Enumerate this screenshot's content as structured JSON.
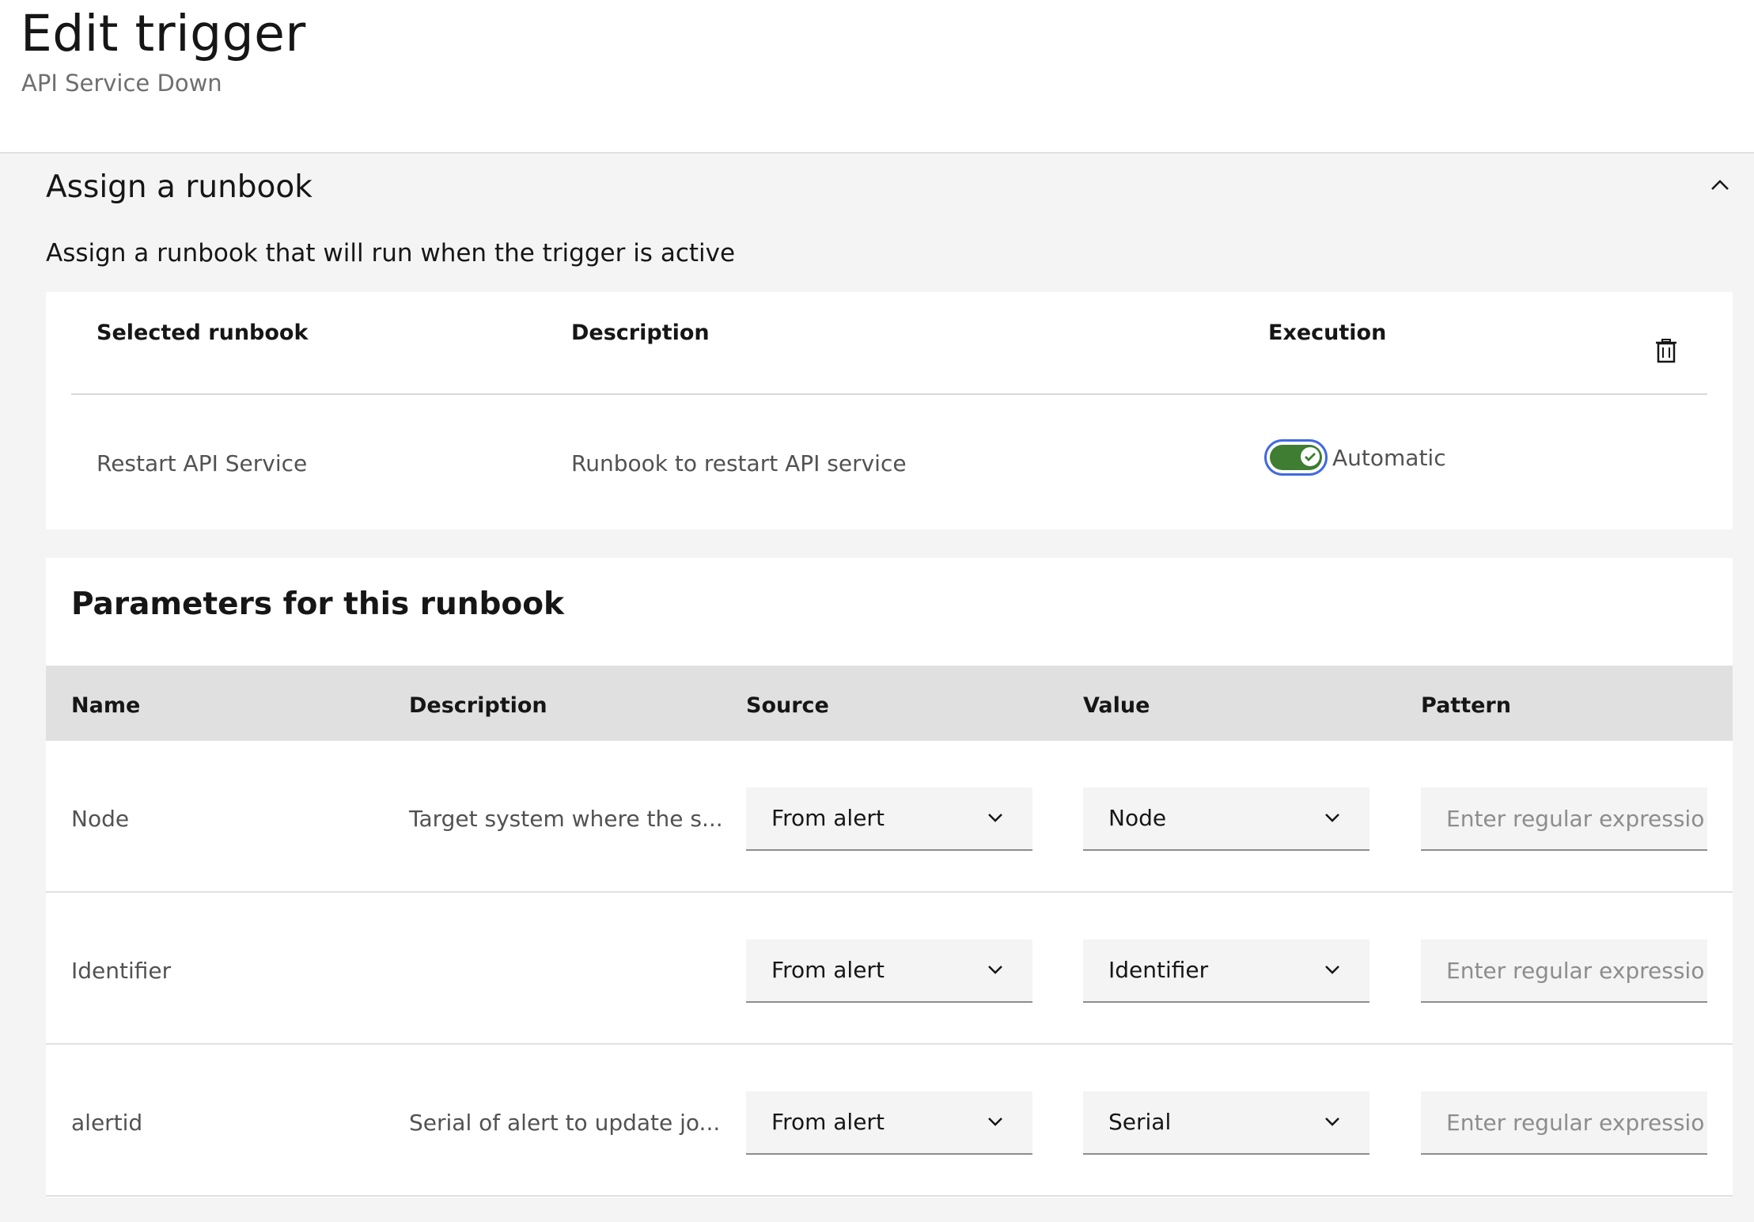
{
  "header": {
    "title": "Edit trigger",
    "subtitle": "API Service Down"
  },
  "assign": {
    "title": "Assign a runbook",
    "description": "Assign a runbook that will run when the trigger is active",
    "columns": {
      "selected_runbook": "Selected runbook",
      "description": "Description",
      "execution": "Execution"
    },
    "row": {
      "name": "Restart API Service",
      "description": "Runbook to restart API service",
      "execution_label": "Automatic",
      "execution_on": true
    }
  },
  "params": {
    "title": "Parameters for this runbook",
    "columns": {
      "name": "Name",
      "description": "Description",
      "source": "Source",
      "value": "Value",
      "pattern": "Pattern"
    },
    "pattern_placeholder": "Enter regular expressio",
    "rows": [
      {
        "name": "Node",
        "description": "Target system where the s...",
        "source": "From alert",
        "value": "Node"
      },
      {
        "name": "Identifier",
        "description": "",
        "source": "From alert",
        "value": "Identifier"
      },
      {
        "name": "alertid",
        "description": "Serial of alert to update jo...",
        "source": "From alert",
        "value": "Serial"
      }
    ]
  },
  "colors": {
    "toggle_on": "#3e7d32",
    "focus_ring": "#4169e1",
    "header_row_bg": "#e0e0e0"
  }
}
